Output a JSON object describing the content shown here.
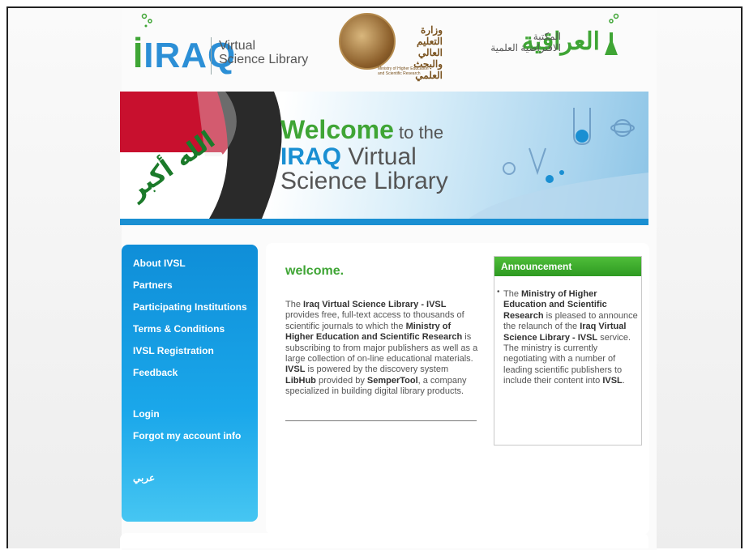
{
  "header": {
    "logo_en_iraq": "IRAQ",
    "logo_en_sub_line1": "Virtual",
    "logo_en_sub_line2": "Science Library",
    "ministry_name_line1": "وزارة التعليم العالي",
    "ministry_name_line2": "والبحث العلمي",
    "ministry_small": "Ministry of Higher Education and Scientific Research",
    "logo_ar_big": "العراقية",
    "logo_ar_small_line1": "المكتبة",
    "logo_ar_small_line2": "الافتراضية العلمية"
  },
  "banner": {
    "welcome": "Welcome",
    "to_the": " to the",
    "iraq": "IRAQ",
    "virtual": " Virtual",
    "science_library": "Science Library"
  },
  "sidebar": {
    "items": [
      {
        "label": "About IVSL"
      },
      {
        "label": "Partners"
      },
      {
        "label": "Participating Institutions"
      },
      {
        "label": "Terms & Conditions"
      },
      {
        "label": "IVSL Registration"
      },
      {
        "label": "Feedback"
      },
      {
        "label": "Login"
      },
      {
        "label": "Forgot my account info"
      },
      {
        "label": "عربي"
      }
    ]
  },
  "main": {
    "heading": "welcome.",
    "p1_a": "The ",
    "p1_b": "Iraq Virtual Science Library - IVSL",
    "p1_c": " provides free, full-text access to thousands of scientific journals to which the ",
    "p1_d": "Ministry of Higher Education and Scientific Research",
    "p1_e": " is subscribing to from major publishers as well as a large collection of on-line educational materials. ",
    "p1_f": "IVSL",
    "p1_g": " is powered by the discovery system ",
    "p1_h": "LibHub",
    "p1_i": " provided by ",
    "p1_j": "SemperTool",
    "p1_k": ", a company specialized in building digital library products."
  },
  "announcement": {
    "title": "Announcement",
    "a1": "The ",
    "a2": "Ministry of Higher Education and Scientific Research",
    "a3": " is pleased to announce the relaunch of the ",
    "a4": "Iraq Virtual Science Library - IVSL",
    "a5": " service.",
    "a6": "The ministry is currently negotiating with a number of leading scientific publishers to include their content into ",
    "a7": "IVSL",
    "a8": "."
  },
  "colors": {
    "brand_green": "#3fa535",
    "brand_blue": "#1a8fd2",
    "sidebar_blue": "#0f8ed8"
  }
}
